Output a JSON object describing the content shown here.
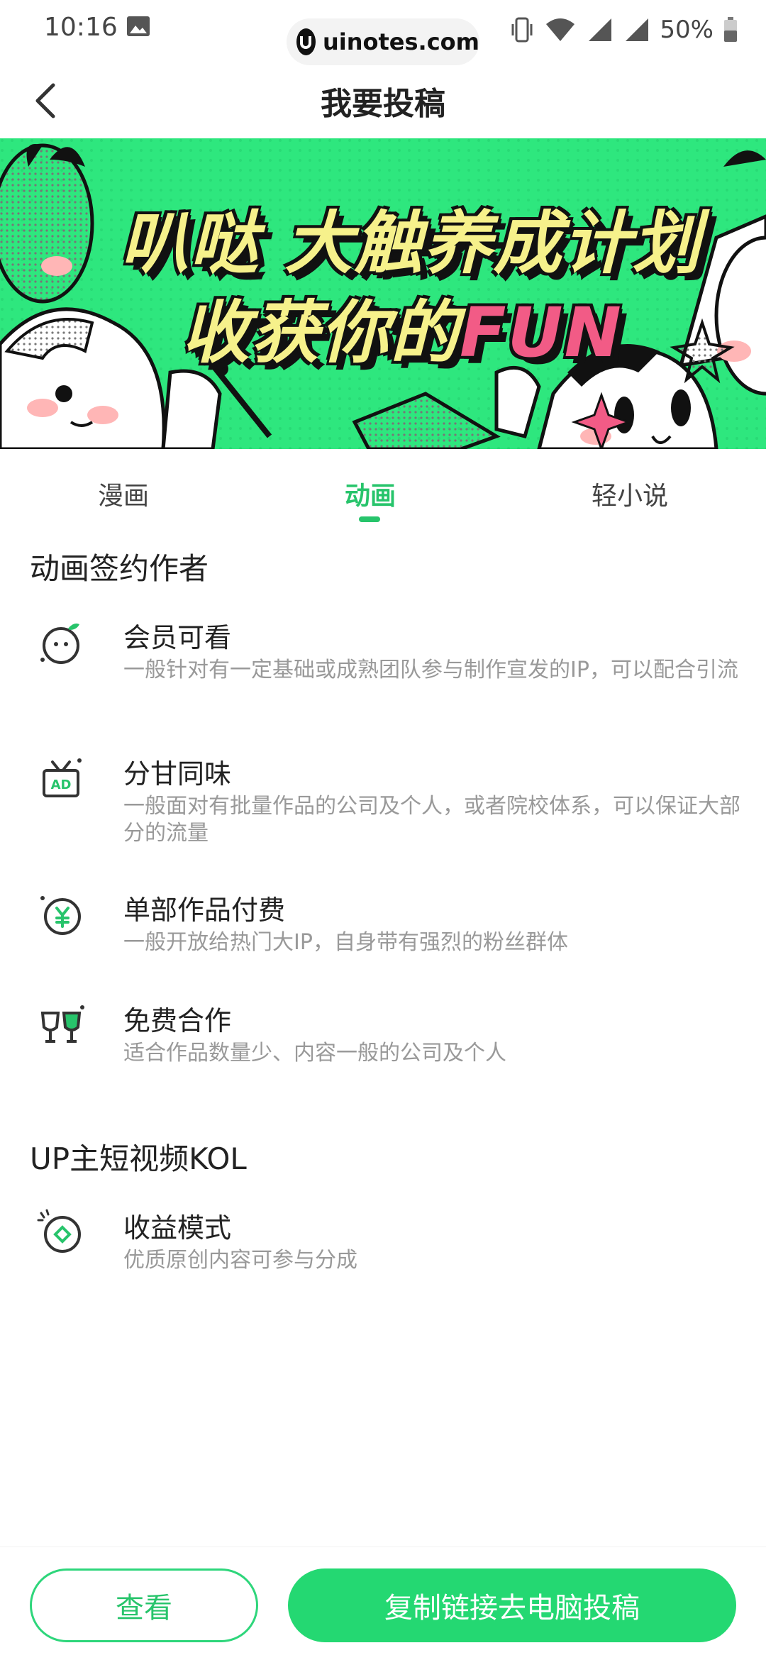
{
  "status_bar": {
    "time": "10:16",
    "battery": "50%",
    "watermark": "uinotes.com"
  },
  "header": {
    "title": "我要投稿"
  },
  "banner": {
    "line1": "叭哒 大触养成计划",
    "line2_prefix": "收获你的",
    "line2_highlight": "FUN"
  },
  "tabs": [
    {
      "label": "漫画",
      "active": false
    },
    {
      "label": "动画",
      "active": true
    },
    {
      "label": "轻小说",
      "active": false
    }
  ],
  "sections": [
    {
      "title": "动画签约作者",
      "items": [
        {
          "icon": "smiley-sprout-icon",
          "title": "会员可看",
          "desc": "一般针对有一定基础或成熟团队参与制作宣发的IP，可以配合引流"
        },
        {
          "icon": "ad-tv-icon",
          "title": "分甘同味",
          "desc": "一般面对有批量作品的公司及个人，或者院校体系，可以保证大部分的流量"
        },
        {
          "icon": "yen-coin-icon",
          "title": "单部作品付费",
          "desc": "一般开放给热门大IP，自身带有强烈的粉丝群体"
        },
        {
          "icon": "cheers-glasses-icon",
          "title": "免费合作",
          "desc": "适合作品数量少、内容一般的公司及个人"
        }
      ]
    },
    {
      "title": "UP主短视频KOL",
      "items": [
        {
          "icon": "diamond-coin-icon",
          "title": "收益模式",
          "desc": "优质原创内容可参与分成"
        }
      ]
    }
  ],
  "actions": {
    "view": "查看",
    "copy_link": "复制链接去电脑投稿"
  },
  "colors": {
    "accent": "#27c46b",
    "button": "#24d872",
    "banner_bg": "#2ee77e"
  }
}
